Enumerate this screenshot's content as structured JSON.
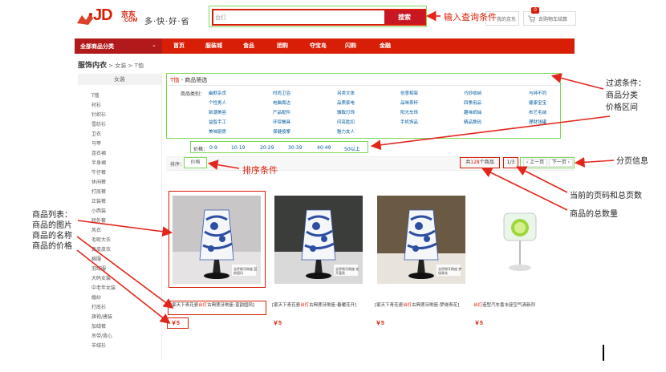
{
  "header": {
    "logo_main": "JD",
    "logo_cn": "京东",
    "logo_com": ".COM",
    "slogan": "多·快·好·省",
    "search_value": "台灯",
    "search_button": "搜索",
    "myjd": "我的京东",
    "cart_label": "去购物车结算",
    "cart_count": "0"
  },
  "nav": {
    "all_categories": "全部商品分类",
    "items": [
      "首页",
      "服装城",
      "食品",
      "团购",
      "夺宝岛",
      "闪购",
      "金融"
    ]
  },
  "breadcrumb": {
    "root": "服饰内衣",
    "level2": "女装",
    "level3": "T恤"
  },
  "sidebar": {
    "head": "女装",
    "items": [
      "T恤",
      "衬衫",
      "针织衫",
      "雪纺衫",
      "卫衣",
      "马甲",
      "连衣裙",
      "半身裙",
      "牛仔裤",
      "休闲裤",
      "打底裤",
      "正装裤",
      "小西装",
      "短外套",
      "风衣",
      "毛呢大衣",
      "真皮皮衣",
      "棉服",
      "羽绒服",
      "大码女装",
      "中老年女装",
      "婚纱",
      "打底衫",
      "旗袍/唐装",
      "加绒裤",
      "吊带/背心",
      "羊绒衫"
    ]
  },
  "filter": {
    "title_keyword": "T恤",
    "title_rest": " - 商品筛选",
    "category_label": "商品类别：",
    "categories": [
      [
        "幽默杂货",
        "时尚卫浴",
        "另类文体",
        "创意相架",
        "巧妙收纳",
        "与钟不同"
      ],
      [
        "个性男人",
        "电脑周边",
        "品质家电",
        "品味茶杯",
        "四季用品",
        "健康宝宝"
      ],
      [
        "新潮美容",
        "产品配件",
        "雅致灯饰",
        "阳光车饰",
        "趣味纸抽",
        "布艺毛绒"
      ],
      [
        "益智手工",
        "环保餐具",
        "闪亮匙扣",
        "手机饰品",
        "精品数码",
        "理财钱罐"
      ],
      [
        "美味厨房",
        "保健按摩",
        "魅力女人"
      ]
    ],
    "price_label": "价格：",
    "price_ranges": [
      "0-9",
      "10-19",
      "20-29",
      "30-39",
      "40-49",
      "50以上"
    ]
  },
  "sortbar": {
    "label": "排序：",
    "option": "价格",
    "count_prefix": "共",
    "count_value": "128",
    "count_suffix": "个商品",
    "page_current": "1/3",
    "prev": "上一页",
    "next": "下一页"
  },
  "products": [
    {
      "name_pre": "[家天下青花瓷",
      "name_hl": "台灯",
      "name_post": "古典莲牙刷座-蓝韵国风]",
      "price": "￥5",
      "image_caption": "全杯刷牙刷座 蓝韵国风"
    },
    {
      "name_pre": "[家天下青花瓷",
      "name_hl": "台灯",
      "name_post": "古典莲牙刷座-春暖花开]",
      "price": "￥5",
      "image_caption": "全杯刷牙刷座 花开富贵"
    },
    {
      "name_pre": "[家天下青花瓷",
      "name_hl": "台灯",
      "name_post": "古典莲牙刷座-梦绕青花]",
      "price": "￥5",
      "image_caption": "全杯刷牙刷座 梦绕青花"
    },
    {
      "name_pre": "",
      "name_hl": "台灯",
      "name_post": "造型汽车香水座空气清新剂",
      "price": "￥5",
      "image_caption": ""
    }
  ],
  "annotations": {
    "search": "输入查询条件",
    "filter": [
      "过滤条件：",
      "商品分类",
      "价格区间"
    ],
    "sort": "排序条件",
    "paging": "分页信息",
    "page_current": "当前的页码和总页数",
    "count": "商品的总数量",
    "list": [
      "商品列表：",
      "商品的图片",
      "商品的名称",
      "商品的价格"
    ]
  },
  "colors": {
    "brand_red": "#d81e06",
    "link_blue": "#005aa0",
    "highlight_green": "#7ed957"
  }
}
